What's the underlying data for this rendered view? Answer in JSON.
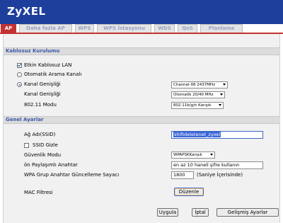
{
  "brand": {
    "logo": "ZyXEL"
  },
  "tabs": [
    {
      "label": "AP",
      "active": true
    },
    {
      "label": "Daha fazla AP"
    },
    {
      "label": "WPS"
    },
    {
      "label": "WPS İstasyonu"
    },
    {
      "label": "WDS"
    },
    {
      "label": "QoS"
    },
    {
      "label": "Planlama"
    }
  ],
  "wireless": {
    "heading": "Kablosuz Kurulumu",
    "enable_label": "Etkin Kablosuz LAN",
    "enable_checked": true,
    "auto_channel_label": "Otomatik Arama Kanalı",
    "channel_radio_label": "Kanal Genişliği",
    "channel_value": "Channel-06 2437MHz",
    "width_label": "Kanal Genişliği",
    "width_value": "Otomatik 20/40 MHz",
    "mode_label": "802.11 Modu",
    "mode_value": "802.11b/g/n Karışık"
  },
  "general": {
    "heading": "Genel Ayarlar",
    "ssid_label": "Ağ Adı(SSID)",
    "ssid_value": "shiftdeletenet_zyxel",
    "hide_ssid_label": "SSID Gizle",
    "security_label": "Güvenlik Modu",
    "security_value": "WPAPSKKarışık",
    "psk_label": "ön Paylaşımlı Anahtar",
    "psk_value": "en az 10 haneli şifre kullanın",
    "rekey_label": "WPA Grup Anahtar Güncelleme Sayacı",
    "rekey_value": "1800",
    "rekey_unit": "(Saniye İçerisinde)",
    "mac_label": "MAC Filtresi",
    "mac_button": "Düzenle"
  },
  "footer": {
    "apply": "Uygula",
    "cancel": "İptal",
    "advanced": "Gelişmiş Ayarlar"
  },
  "colors": {
    "header_blue": "#1e3f9c",
    "tab_active_red": "#c43131",
    "section_text": "#3f5aa8"
  }
}
